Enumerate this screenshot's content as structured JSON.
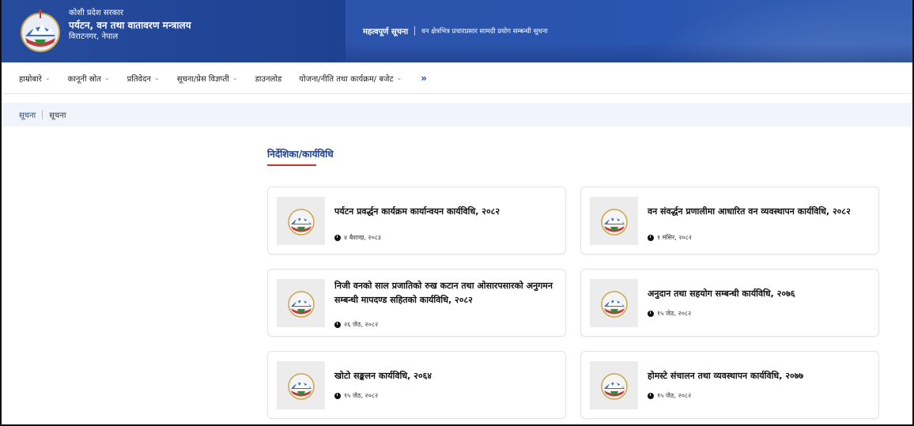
{
  "header": {
    "org_line1": "कोशी प्रदेश सरकार",
    "org_line2": "पर्यटन, वन तथा वातावरण मन्त्रालय",
    "org_line3": "विराटनगर, नेपाल",
    "notice_label": "महत्वपूर्ण सूचना",
    "notice_text": "वन क्षेत्रभित्र प्रचारप्रसार सामग्री प्रयोग सम्बन्धी सूचना"
  },
  "nav": {
    "items": [
      {
        "label": "हाम्रोबारे",
        "has_dropdown": true
      },
      {
        "label": "कानूनी स्रोत",
        "has_dropdown": true
      },
      {
        "label": "प्रतिवेदन",
        "has_dropdown": true
      },
      {
        "label": "सूचना/प्रेस विज्ञप्ती",
        "has_dropdown": true
      },
      {
        "label": "डाउनलोड",
        "has_dropdown": false
      },
      {
        "label": "योजना/नीति तथा कार्यक्रम/ बजेट",
        "has_dropdown": true
      }
    ],
    "more": "»"
  },
  "breadcrumb": {
    "home": "सूचना",
    "current": "सूचना"
  },
  "section": {
    "title": "निर्देशिका/कार्यविधि"
  },
  "cards": [
    {
      "title": "पर्यटन प्रवर्द्धन कार्यक्रम कार्यान्वयन कार्यविधि, २०८२",
      "date": "४ बैशाख, २०८३"
    },
    {
      "title": "वन संवर्द्धन प्रणालीमा आधारित वन व्यवस्थापन कार्यविधि, २०८२",
      "date": "१ मंसिर, २०८२"
    },
    {
      "title": "निजी वनको साल प्रजातिको रुख कटान तथा ओसारपसारको अनुगमन सम्बन्धी मापदण्ड सहितको कार्यविधि, २०८२",
      "date": "२६ जेठ, २०८२"
    },
    {
      "title": "अनुदान तथा सहयोग सम्बन्धी कार्यविधि, २०७६",
      "date": "१५ जेठ, २०८२"
    },
    {
      "title": "खोटो सङ्कलन कार्यविधि, २०६४",
      "date": "१५ जेठ, २०८२"
    },
    {
      "title": "होमस्टे संचालन तथा व्यवस्थापन कार्यविधि, २०७७",
      "date": "१५ जेठ, २०८२"
    }
  ],
  "colors": {
    "header_blue": "#1d3f8f",
    "accent_red": "#d32f2f",
    "link_blue": "#1d47b5"
  },
  "icons": {
    "emblem": "nepal-emblem-icon",
    "clock": "clock-icon"
  }
}
